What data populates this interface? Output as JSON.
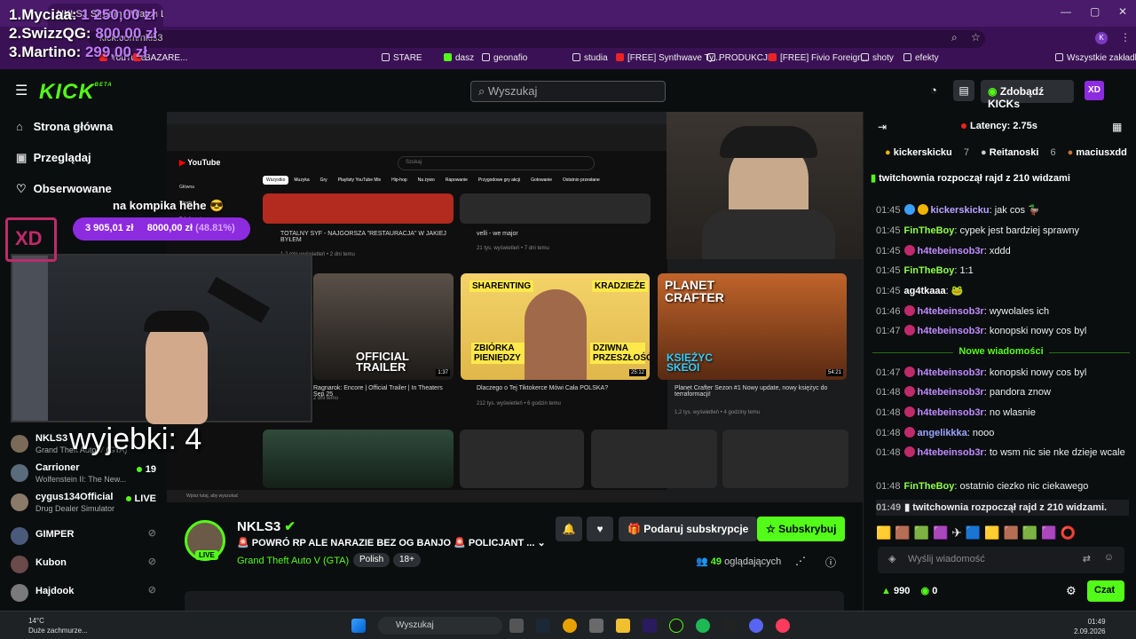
{
  "browser": {
    "tab_title": "NKLS3 Stream - Watch Live on Kick",
    "url": "kick.com/nkls3",
    "bookmarks": [
      "YouTube",
      "BAZARE...",
      "STARE",
      "dasz",
      "geonafio",
      "studia",
      "[FREE] Synthwave Ty...",
      "PRODUKCJE",
      "[FREE] Fivio Foreign...",
      "shoty",
      "efekty",
      "Wszystkie zakładki"
    ]
  },
  "overlay": {
    "leaderboard": [
      {
        "rank": "1.",
        "name": "Myciaa:",
        "amount": "1 250,00 zł"
      },
      {
        "rank": "2.",
        "name": "SwizzQG:",
        "amount": "800,00 zł"
      },
      {
        "rank": "3.",
        "name": "Martino:",
        "amount": "299,00 zł"
      }
    ],
    "goal_text": "na kompika hehe 😎",
    "goal_current": "3 905,01 zł",
    "goal_target": "8000,00 zł",
    "goal_percent": "(48.81%)",
    "big_text": "wyjebki: 4"
  },
  "kick": {
    "logo": "KICK",
    "logo_beta": "BETA",
    "search_placeholder": "Wyszukaj",
    "get_kicks": "Zdobądź KICKs"
  },
  "sidebar": {
    "nav": [
      {
        "label": "Strona główna",
        "icon": "home-icon"
      },
      {
        "label": "Przeglądaj",
        "icon": "browse-icon"
      },
      {
        "label": "Obserwowane",
        "icon": "heart-icon"
      }
    ],
    "channels": [
      {
        "name": "NKLS3",
        "game": "Grand Theft Auto V (GTA)",
        "viewers": "",
        "color": "#7b6a58"
      },
      {
        "name": "Carrioner",
        "game": "Wolfenstein II: The New...",
        "viewers": "19",
        "color": "#5a6b7c"
      },
      {
        "name": "cygus134Official",
        "game": "Drug Dealer Simulator",
        "viewers": "LIVE",
        "color": "#8a7a6a"
      },
      {
        "name": "GIMPER",
        "game": "",
        "viewers": "",
        "color": "#4a5a7a"
      },
      {
        "name": "Kubon",
        "game": "",
        "viewers": "",
        "color": "#6a4a4a"
      },
      {
        "name": "Hajdook",
        "game": "",
        "viewers": "",
        "color": "#7a7a7a"
      }
    ]
  },
  "youtube": {
    "logo": "YouTube",
    "search_placeholder": "Szukaj",
    "filters": [
      "Wszystko",
      "Muzyka",
      "Gry",
      "Playlisty YouTube Mix",
      "Hip-hop",
      "Na żywo",
      "Rapowanie",
      "Przygodowe gry akcji",
      "Gotowanie",
      "Ostatnio przesłane"
    ],
    "side": [
      "Główna",
      "Shorts",
      "Subskrypcje"
    ],
    "videos_top": [
      {
        "title": "TOTALNY SYF - NAJGORSZA \"RESTAURACJA\" W JAKIEJ BYŁEM",
        "meta": "1,2 mln wyświetleń • 2 dni temu"
      },
      {
        "title": "velli - we major",
        "meta": "21 tys. wyświetleń • 7 dni temu"
      }
    ],
    "videos": [
      {
        "title": "Ragnarok: Encore | Official Trailer | In Theaters Sep 25",
        "meta": "2 dni temu",
        "thumb_text": "OFFICIAL TRAILER",
        "duration": "1:37"
      },
      {
        "title": "Dlaczego o Tej Tiktokerce Mówi Cała POLSKA?",
        "meta": "212 tys. wyświetleń • 6 godzin temu",
        "thumb_text": "SHARENTING",
        "duration": "25:12"
      },
      {
        "title": "Planet Crafter Sezon #1 Nowy update, nowy księżyc do terraformacji!",
        "meta": "1,2 tys. wyświetleń • 4 godziny temu",
        "thumb_text": "PLANET CRAFTER",
        "duration": "54:21"
      }
    ],
    "thumb2_words": [
      "KRADZIEŻE",
      "ZBIÓRKA PIENIĘDZY",
      "DZIWNA PRZESZŁOŚĆ"
    ],
    "thumb3_sub": "KSIĘŻYC SKEOI",
    "inner_search": "Wpisz tutaj, aby wyszukać"
  },
  "stream": {
    "name": "NKLS3",
    "title": "🚨 POWRÓ RP ALE NARAZIE BEZ OG BANJO 🚨 POLICJANT ...",
    "game": "Grand Theft Auto V (GTA)",
    "tags": [
      "Polish",
      "18+"
    ],
    "live": "LIVE",
    "gift_subs": "Podaruj subskrypcje",
    "subscribe": "Subskrybuj",
    "viewers_count": "49",
    "viewers_label": "oglądających"
  },
  "chat": {
    "latency": "Latency: 2.75s",
    "gifters": [
      {
        "name": "kickerskicku",
        "count": "7"
      },
      {
        "name": "Reitanoski",
        "count": "6"
      },
      {
        "name": "maciusxdd",
        "count": "5"
      }
    ],
    "raid_pin": "twitchownia rozpoczął rajd z 210 widzami",
    "new_messages": "Nowe wiadomości",
    "messages": [
      {
        "time": "01:45",
        "user": "kickerskicku",
        "text": "jak cos 🦆",
        "color": "#b9a3ff"
      },
      {
        "time": "01:45",
        "user": "FinTheBoy",
        "text": "cypek jest bardziej sprawny",
        "color": "#8cff4a"
      },
      {
        "time": "01:45",
        "user": "h4tebeinsob3r",
        "text": "xddd",
        "color": "#c08bff"
      },
      {
        "time": "01:45",
        "user": "FinTheBoy",
        "text": "1:1",
        "color": "#8cff4a"
      },
      {
        "time": "01:45",
        "user": "ag4tkaaa",
        "text": "🐸",
        "color": "#ffffff"
      },
      {
        "time": "01:46",
        "user": "h4tebeinsob3r",
        "text": "wywolales ich",
        "color": "#c08bff"
      },
      {
        "time": "01:47",
        "user": "h4tebeinsob3r",
        "text": "konopski nowy cos byl",
        "color": "#c08bff"
      },
      {
        "time": "01:47",
        "user": "h4tebeinsob3r",
        "text": "konopski nowy cos byl",
        "color": "#c08bff"
      },
      {
        "time": "01:48",
        "user": "h4tebeinsob3r",
        "text": "pandora znow",
        "color": "#c08bff"
      },
      {
        "time": "01:48",
        "user": "h4tebeinsob3r",
        "text": "no wlasnie",
        "color": "#c08bff"
      },
      {
        "time": "01:48",
        "user": "angelikkka",
        "text": "nooo",
        "color": "#9aa4ff"
      },
      {
        "time": "01:48",
        "user": "h4tebeinsob3r",
        "text": "to wsm nic sie nke dzieje wcale",
        "color": "#c08bff"
      },
      {
        "time": "01:48",
        "user": "FinTheBoy",
        "text": "ostatnio ciezko nic ciekawego",
        "color": "#8cff4a"
      }
    ],
    "raid_msg_time": "01:49",
    "raid_msg": "twitchownia rozpoczął rajd z 210 widzami.",
    "input_placeholder": "Wyślij wiadomość",
    "points": "990",
    "kicks": "0",
    "send": "Czat"
  },
  "taskbar": {
    "temp": "14°C",
    "weather": "Duże zachmurze...",
    "search": "Wyszukaj",
    "time": "01:49",
    "date": "2.09.2026"
  },
  "colors": {
    "kick_green": "#53fc18",
    "purple": "#8d2be0",
    "chrome": "#3b1156"
  }
}
